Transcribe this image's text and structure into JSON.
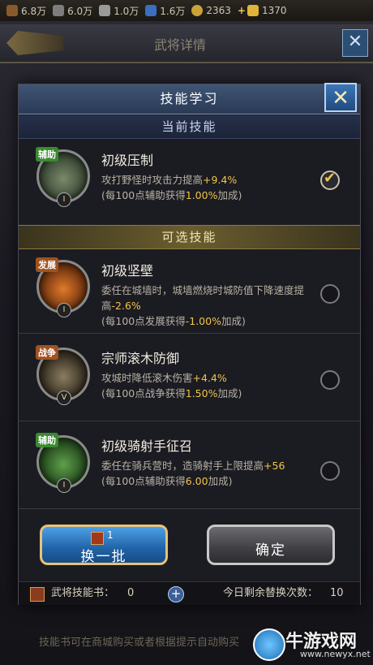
{
  "topbar": {
    "resources": [
      {
        "icon": "wood-icon",
        "value": "6.8万",
        "color": "#8b5a2b"
      },
      {
        "icon": "iron-icon",
        "value": "6.0万",
        "color": "#7d7d7d"
      },
      {
        "icon": "food-icon",
        "value": "1.0万",
        "color": "#9a9a9a"
      },
      {
        "icon": "crystal-icon",
        "value": "1.6万",
        "color": "#3a6fbf"
      },
      {
        "icon": "coin-icon",
        "value": "2363",
        "color": "#c9a23a"
      },
      {
        "icon": "gold-ingot-icon",
        "value": "1370",
        "color": "#e0b43a"
      }
    ],
    "add_label": "+"
  },
  "background": {
    "title": "武将详情",
    "hint": "技能书可在商城购买或者根据提示自动购买"
  },
  "dialog": {
    "title": "技能学习",
    "section_current": "当前技能",
    "section_optional": "可选技能",
    "current_skill": {
      "name": "初级压制",
      "badge": "辅助",
      "level": "I",
      "desc_prefix": "攻打野怪时攻击力提高",
      "desc_value": "+9.4%",
      "desc_note_prefix": "(每100点辅助获得",
      "desc_note_value": "1.00%",
      "desc_note_suffix": "加成)",
      "selected": true
    },
    "optional_skills": [
      {
        "name": "初级坚壁",
        "badge": "发展",
        "level": "I",
        "desc_prefix": "委任在城墙时，城墙燃烧时城防值下降速度提高",
        "desc_value": "-2.6%",
        "desc_note_prefix": "(每100点发展获得",
        "desc_note_value": "-1.00%",
        "desc_note_suffix": "加成)"
      },
      {
        "name": "宗师滚木防御",
        "badge": "战争",
        "level": "V",
        "desc_prefix": "攻城时降低滚木伤害",
        "desc_value": "+4.4%",
        "desc_note_prefix": "(每100点战争获得",
        "desc_note_value": "1.50%",
        "desc_note_suffix": "加成)"
      },
      {
        "name": "初级骑射手征召",
        "badge": "辅助",
        "level": "I",
        "desc_prefix": "委任在骑兵营时，造骑射手上限提高",
        "desc_value": "+56",
        "desc_note_prefix": "(每100点辅助获得",
        "desc_note_value": "6.00",
        "desc_note_suffix": "加成)"
      }
    ],
    "refresh_button": {
      "label": "换一批",
      "cost": "1"
    },
    "confirm_button": {
      "label": "确定"
    },
    "footer": {
      "skill_book_label": "武将技能书：",
      "skill_book_count": "0",
      "add_label": "+",
      "remaining_label": "今日剩余替换次数：",
      "remaining_value": "10"
    }
  },
  "watermark": {
    "text": "牛游戏网",
    "url": "www.newyx.net"
  }
}
